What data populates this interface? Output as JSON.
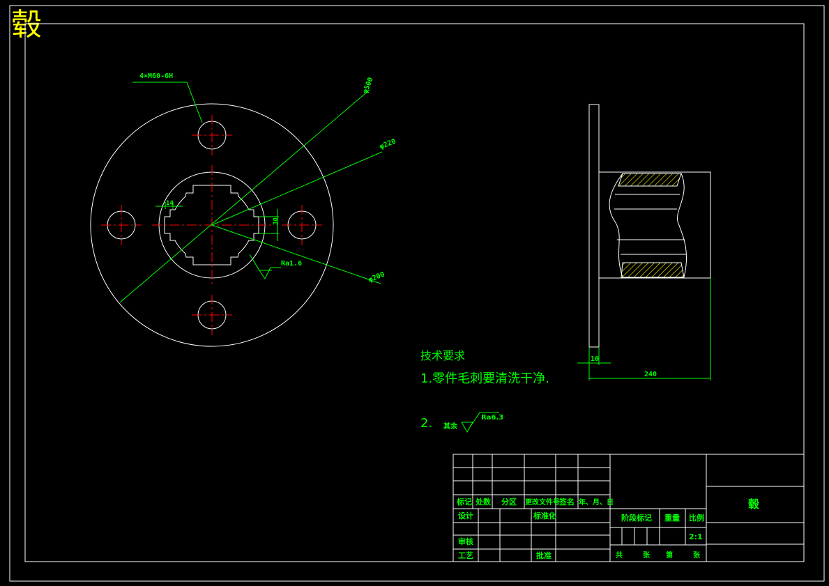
{
  "title_corner": "毂",
  "front_view": {
    "hole_note": "4×M60-6H",
    "dia_outer": "φ500",
    "dia_mid": "φ220",
    "dia_inner": "φ200",
    "keyway_width": "14",
    "keyway_depth": "30",
    "roughness": "Ra1.6"
  },
  "side_view": {
    "dim_flange": "10",
    "dim_length": "240"
  },
  "notes": {
    "heading": "技术要求",
    "line1": "1.零件毛刺要清洗干净.",
    "line2_prefix": "2.",
    "line2_text": "其余",
    "line2_roughness": "Ra6.3"
  },
  "title_block": {
    "row_labels": [
      "标记",
      "处数",
      "分区",
      "更改文件号",
      "签名",
      "年、月、日"
    ],
    "design": "设计",
    "standard": "标准化",
    "review": "审核",
    "process": "工艺",
    "approve": "批准",
    "stage_mark": "阶段标记",
    "weight": "重量",
    "scale_label": "比例",
    "scale_value": "2:1",
    "part_name": "毂",
    "sheets_total": "共",
    "sheets_unit": "张",
    "sheet_no": "第",
    "sheet_unit2": "张"
  },
  "colors": {
    "outline": "#ffffff",
    "dimension": "#00ff00",
    "centerline": "#ff0000",
    "title": "#ffff00",
    "hatch": "#ffff00"
  }
}
